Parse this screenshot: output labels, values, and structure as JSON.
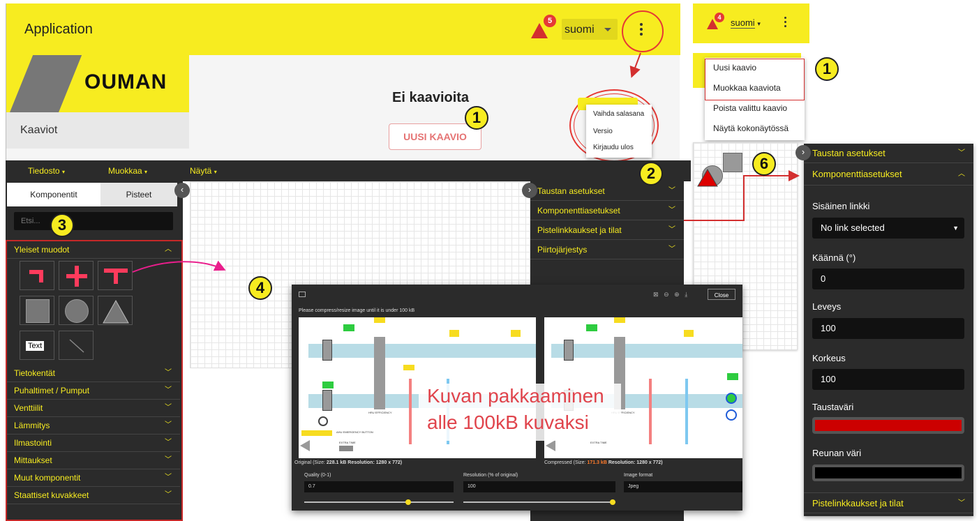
{
  "app": {
    "title": "Application",
    "lang": "suomi",
    "alert_count": "5",
    "alert_count_small": "4",
    "logo": "OUMAN",
    "nav_item": "Kaaviot"
  },
  "empty": {
    "title": "Ei kaavioita",
    "button": "UUSI KAAVIO"
  },
  "user_menu": [
    "Vaihda salasana",
    "Versio",
    "Kirjaudu ulos"
  ],
  "diagram_menu": [
    "Uusi kaavio",
    "Muokkaa kaaviota",
    "Poista valittu kaavio",
    "Näytä kokonäytössä"
  ],
  "toolbar": [
    "Tiedosto",
    "Muokkaa",
    "Näytä"
  ],
  "tabs": [
    "Komponentit",
    "Pisteet"
  ],
  "search": {
    "placeholder": "Etsi..."
  },
  "categories": {
    "open": "Yleiset muodot",
    "text_tile": "Text",
    "closed": [
      "Tietokentät",
      "Puhaltimet / Pumput",
      "Venttiilit",
      "Lämmitys",
      "Ilmastointi",
      "Mittaukset",
      "Muut komponentit",
      "Staattiset kuvakkeet"
    ]
  },
  "right_sections": [
    "Taustan asetukset",
    "Komponenttiasetukset",
    "Pistelinkkaukset ja tilat",
    "Piirtojärjestys"
  ],
  "props": {
    "panel_taustan": "Taustan asetukset",
    "panel_komp": "Komponenttiasetukset",
    "link_label": "Sisäinen linkki",
    "link_value": "No link selected",
    "rotate_label": "Käännä (°)",
    "rotate_value": "0",
    "width_label": "Leveys",
    "width_value": "100",
    "height_label": "Korkeus",
    "height_value": "100",
    "bg_label": "Taustaväri",
    "bg_color": "#cc0000",
    "border_label": "Reunan väri",
    "border_color": "#000000",
    "footer": "Pistelinkkaukset ja tilat"
  },
  "dialog": {
    "notice": "Please compress/resize image until it is under 100 kB",
    "close": "Close",
    "orig_info_prefix": "Original (Size: ",
    "orig_size": "228.1 kB",
    "orig_res": " Resolution: 1280 x 772)",
    "comp_info_prefix": "Compressed (Size: ",
    "comp_size": "171.3 kB",
    "comp_res": " Resolution: 1280 x 772)",
    "quality_label": "Quality (0-1)",
    "quality_value": "0.7",
    "res_label": "Resolution (% of original)",
    "res_value": "100",
    "format_label": "Image format",
    "format_value": "Jpeg",
    "hru_label": "HRU EFFICIENCY",
    "ahu_label": "AHU EMERGENCY BUTTON",
    "extra_label": "EXTRA TIME",
    "overlay_line1": "Kuvan pakkaaminen",
    "overlay_line2": "alle 100kB kuvaksi"
  },
  "callouts": [
    "1",
    "1",
    "1",
    "2",
    "3",
    "4",
    "6"
  ],
  "colors": {
    "brand": "#f7ec20",
    "dark": "#2b2b2b",
    "accent_red": "#e53935",
    "annotation_red": "#d32f2f",
    "pink_arrow": "#e91e8c"
  }
}
